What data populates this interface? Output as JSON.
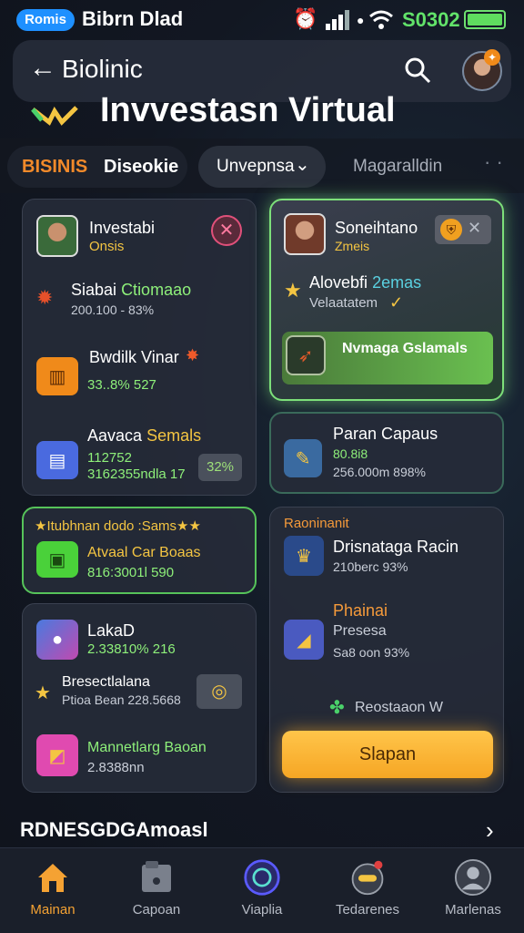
{
  "status_bar": {
    "carrier_pill": "Romis",
    "carrier_name": "Bibrn Dlad",
    "clock": "S0302"
  },
  "header": {
    "back_title": "Biolinic",
    "page_title": "Invvestasn Virtual"
  },
  "filters": {
    "chip_accent": "BISINIS",
    "chip_label": "Diseokie",
    "dropdown_label": "Unvepnsa",
    "tab_label": "Magaralldin",
    "more": "· ·"
  },
  "left_cards": [
    {
      "title": "Investabi",
      "subtitle": "Onsis",
      "rows": [
        {
          "label": "Siabai",
          "label_accent": "Ctiomaao",
          "value": "200.100 - 83%"
        },
        {
          "label": "Bwdilk Vinar",
          "value": "33..8% 527"
        },
        {
          "label": "Aavaca",
          "label_accent": "Semals",
          "value1": "112752",
          "value2": "3162355ndla 17",
          "badge": "32%"
        }
      ]
    },
    {
      "heading": "★Itubhnan dodo :Sams★★",
      "title": "Atvaal Car Boaas",
      "value": "816:3001l 590"
    },
    {
      "rows": [
        {
          "label": "LakaD",
          "value": "2.33810% 216"
        },
        {
          "label": "Bresectlalana",
          "value": "Ptioa Bean 228.5668"
        },
        {
          "label": "Mannetlarg Baoan",
          "value": "2.8388nn"
        }
      ]
    }
  ],
  "right_cards": [
    {
      "title": "Soneihtano",
      "subtitle": "Zmeis",
      "row_title": "Alovebfi",
      "row_accent": "2emas",
      "row_sub": "Velaatatem",
      "banner": "Nvmaga Gslamals"
    },
    {
      "title": "Paran Capaus",
      "value1": "80.8i8",
      "value2": "256.000m 898%"
    },
    {
      "heading": "Raoninanit",
      "row1_title": "Drisnataga Racin",
      "row1_value": "210berc 93%",
      "row2_heading": "Phainai",
      "row2_title": "Presesa",
      "row2_value": "Sa8 oon 93%",
      "link": "Reostaaon W",
      "cta": "Slapan"
    }
  ],
  "section": {
    "heading": "RDNESGDGAmoasl"
  },
  "bottom_nav": [
    {
      "label": "Mainan",
      "icon": "home-icon",
      "active": true
    },
    {
      "label": "Capoan",
      "icon": "folder-icon"
    },
    {
      "label": "Viaplia",
      "icon": "circle-icon"
    },
    {
      "label": "Tedarenes",
      "icon": "globe-icon"
    },
    {
      "label": "Marlenas",
      "icon": "profile-icon"
    }
  ],
  "colors": {
    "accent_orange": "#f5a233",
    "accent_green": "#8ef07a",
    "accent_yellow": "#f4c542",
    "background": "#121722"
  }
}
